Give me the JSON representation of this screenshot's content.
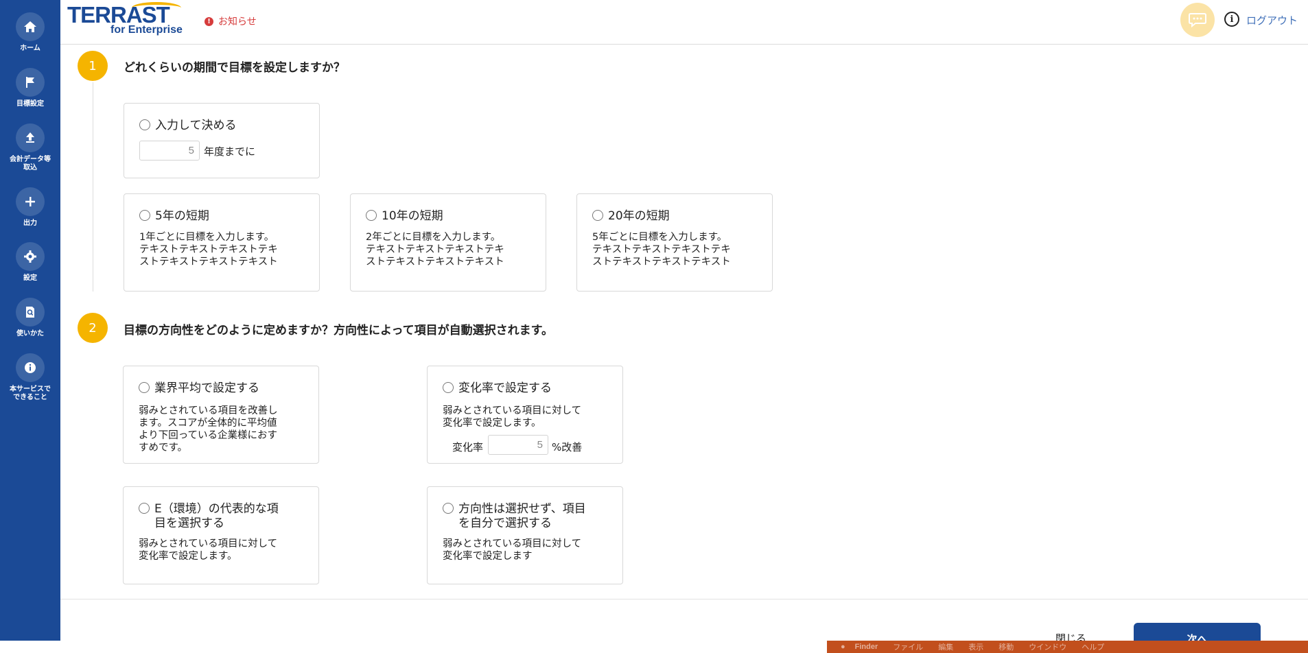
{
  "sidebar": {
    "items": [
      {
        "label": "ホーム",
        "icon": "home-icon"
      },
      {
        "label": "目標設定",
        "icon": "flag-icon"
      },
      {
        "label": "会計データ等\n取込",
        "icon": "upload-icon"
      },
      {
        "label": "出力",
        "icon": "plus-icon"
      },
      {
        "label": "設定",
        "icon": "gear-icon"
      },
      {
        "label": "使いかた",
        "icon": "document-search-icon"
      },
      {
        "label": "本サービスで\nできること",
        "icon": "info-icon"
      }
    ]
  },
  "header": {
    "logo_main": "TERRAST",
    "logo_sub": "for Enterprise",
    "notice": "お知らせ",
    "logout": "ログアウト"
  },
  "step1": {
    "number": "1",
    "title": "どれくらいの期間で目標を設定しますか？",
    "custom": {
      "label": "入力して決める",
      "value": "5",
      "suffix": "年度までに"
    },
    "options": [
      {
        "label": "5年の短期",
        "desc": "1年ごとに目標を入力します。\nテキストテキストテキストテキ\nストテキストテキストテキスト"
      },
      {
        "label": "10年の短期",
        "desc": "2年ごとに目標を入力します。\nテキストテキストテキストテキ\nストテキストテキストテキスト"
      },
      {
        "label": "20年の短期",
        "desc": "5年ごとに目標を入力します。\nテキストテキストテキストテキ\nストテキストテキストテキスト"
      }
    ]
  },
  "step2": {
    "number": "2",
    "title": "目標の方向性をどのように定めますか？方向性によって項目が自動選択されます。",
    "options": [
      {
        "label": "業界平均で設定する",
        "desc": "弱みとされている項目を改善し\nます。スコアが全体的に平均値\nより下回っている企業様におす\nすめです。"
      },
      {
        "label": "変化率で設定する",
        "desc": "弱みとされている項目に対して\n変化率で設定します。",
        "rate_label": "変化率",
        "rate_value": "5",
        "rate_suffix": "%改善"
      },
      {
        "label": "E（環境）の代表的な項\n目を選択する",
        "desc": "弱みとされている項目に対して\n変化率で設定します。"
      },
      {
        "label": "方向性は選択せず、項目\nを自分で選択する",
        "desc": "弱みとされている項目に対して\n変化率で設定します"
      }
    ]
  },
  "footer": {
    "close": "閉じる",
    "next": "次へ"
  },
  "menubar": {
    "items": [
      "Finder",
      "ファイル",
      "編集",
      "表示",
      "移動",
      "ウインドウ",
      "ヘルプ"
    ]
  },
  "colors": {
    "primary": "#1b4a96",
    "accent": "#f5b400",
    "notice": "#d63c3c",
    "link": "#3f6fb8"
  }
}
